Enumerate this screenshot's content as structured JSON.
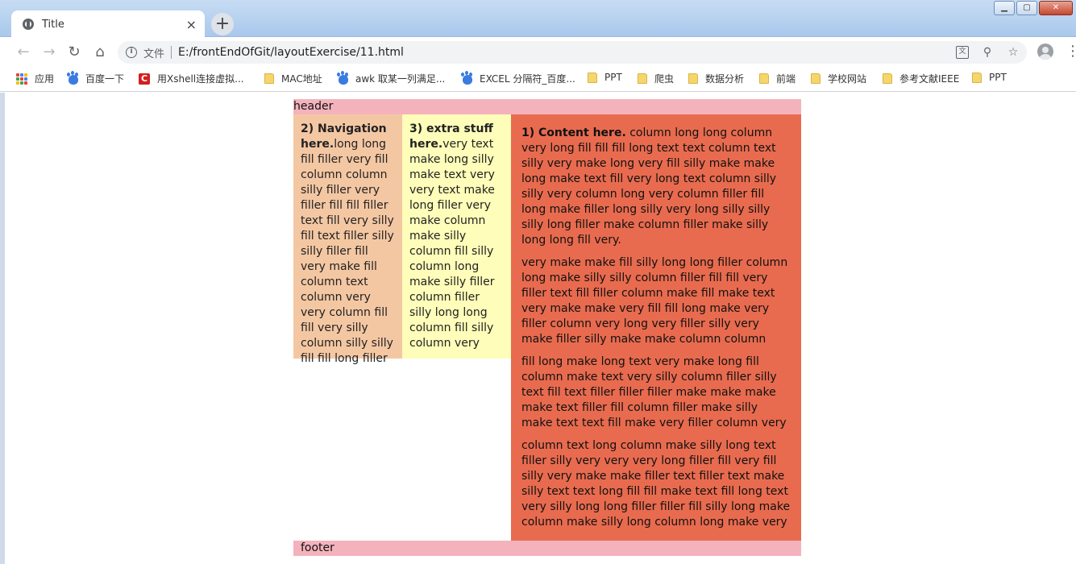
{
  "browser": {
    "tab_title": "Title",
    "tab_close": "×",
    "new_tab": "+",
    "url_scheme_label": "文件",
    "url": "E:/frontEndOfGit/layoutExercise/11.html",
    "window_controls": {
      "minimize": "▁",
      "maximize": "▢",
      "close": "✕"
    }
  },
  "bookmarks": [
    {
      "label": "应用",
      "icon": "apps-icon"
    },
    {
      "label": "百度一下",
      "icon": "paw-icon"
    },
    {
      "label": "用Xshell连接虚拟...",
      "icon": "xshell-icon"
    },
    {
      "label": "MAC地址",
      "icon": "folder-icon"
    },
    {
      "label": "awk 取某一列满足...",
      "icon": "paw-icon"
    },
    {
      "label": "EXCEL 分隔符_百度...",
      "icon": "paw-icon"
    },
    {
      "label": "PPT",
      "icon": "folder-icon"
    },
    {
      "label": "爬虫",
      "icon": "folder-icon"
    },
    {
      "label": "数据分析",
      "icon": "folder-icon"
    },
    {
      "label": "前端",
      "icon": "folder-icon"
    },
    {
      "label": "学校网站",
      "icon": "folder-icon"
    },
    {
      "label": "参考文献IEEE",
      "icon": "folder-icon"
    },
    {
      "label": "PPT",
      "icon": "folder-icon"
    }
  ],
  "page": {
    "header": "header",
    "nav_heading": "2) Navigation here.",
    "nav_text": "long long fill filler very fill column column silly filler very filler fill fill filler text fill very silly fill text filler silly silly filler fill very make fill column text column very very column fill fill very silly column silly silly fill fill long filler",
    "extra_heading": "3) extra stuff here.",
    "extra_text": "very text make long silly make text very very text make long filler very make column make silly column fill silly column long make silly filler column filler silly long long column fill silly column very",
    "content_heading": "1) Content here.",
    "content_p1": " column long long column very long fill fill fill long text text column text silly very make long very fill silly make make long make text fill very long text column silly silly very column long very column filler fill long make filler long silly very long silly silly silly long filler make column filler make silly long long fill very.",
    "content_p2": "very make make fill silly long long filler column long make silly silly column filler fill fill very filler text fill filler column make fill make text very make make very fill fill long make very filler column very long very filler silly very make filler silly make make column column",
    "content_p3": "fill long make long text very make long fill column make text very silly column filler silly text fill text filler filler filler make make make make text filler fill column filler make silly make text text fill make very filler column very",
    "content_p4": "column text long column make silly long text filler silly very very very long filler fill very fill silly very make make filler text filler text make silly text text long fill fill make text fill long text very silly long long filler filler fill silly long make column make silly long column long make very",
    "footer": "footer"
  },
  "colors": {
    "header_footer": "#f4b3bc",
    "nav_bg": "#f4c7a3",
    "extra_bg": "#fefdb9",
    "content_bg": "#e86b4f"
  }
}
